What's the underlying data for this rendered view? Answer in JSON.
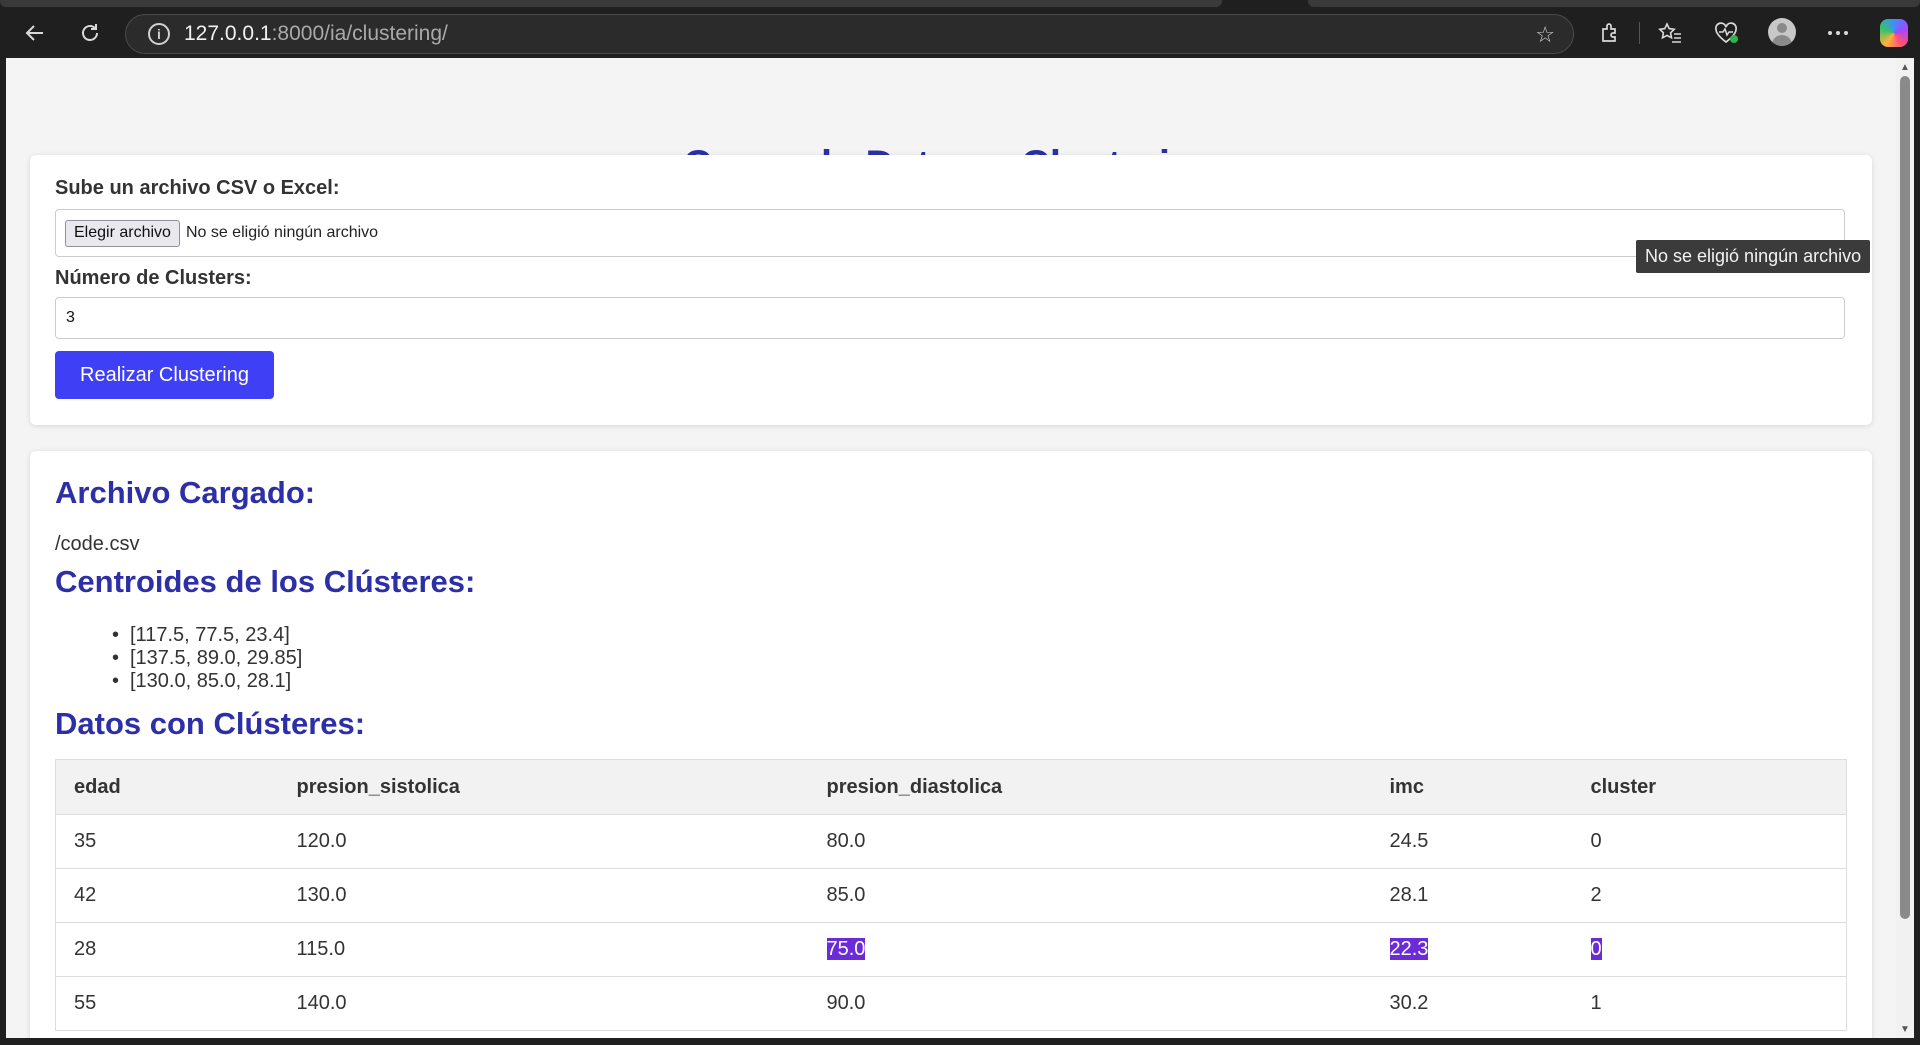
{
  "browser": {
    "url_host": "127.0.0.1",
    "url_path": ":8000/ia/clustering/"
  },
  "page": {
    "title": "Carga de Datos y Clustering"
  },
  "upload_form": {
    "file_label": "Sube un archivo CSV o Excel:",
    "file_button": "Elegir archivo",
    "file_status": "No se eligió ningún archivo",
    "clusters_label": "Número de Clusters:",
    "clusters_value": "3",
    "submit_label": "Realizar Clustering",
    "tooltip": "No se eligió ningún archivo"
  },
  "results": {
    "loaded_heading": "Archivo Cargado:",
    "loaded_path": "/code.csv",
    "centroids_heading": "Centroides de los Clústeres:",
    "centroids": [
      "[117.5, 77.5, 23.4]",
      "[137.5, 89.0, 29.85]",
      "[130.0, 85.0, 28.1]"
    ],
    "data_heading": "Datos con Clústeres:",
    "columns": [
      "edad",
      "presion_sistolica",
      "presion_diastolica",
      "imc",
      "cluster"
    ],
    "rows": [
      [
        "35",
        "120.0",
        "80.0",
        "24.5",
        "0"
      ],
      [
        "42",
        "130.0",
        "85.0",
        "28.1",
        "2"
      ],
      [
        "28",
        "115.0",
        "75.0",
        "22.3",
        "0"
      ],
      [
        "55",
        "140.0",
        "90.0",
        "30.2",
        "1"
      ]
    ]
  },
  "colors": {
    "heading": "#2c2fa5",
    "primary_button": "#3f3ff5",
    "selection": "#6b2bd6"
  }
}
